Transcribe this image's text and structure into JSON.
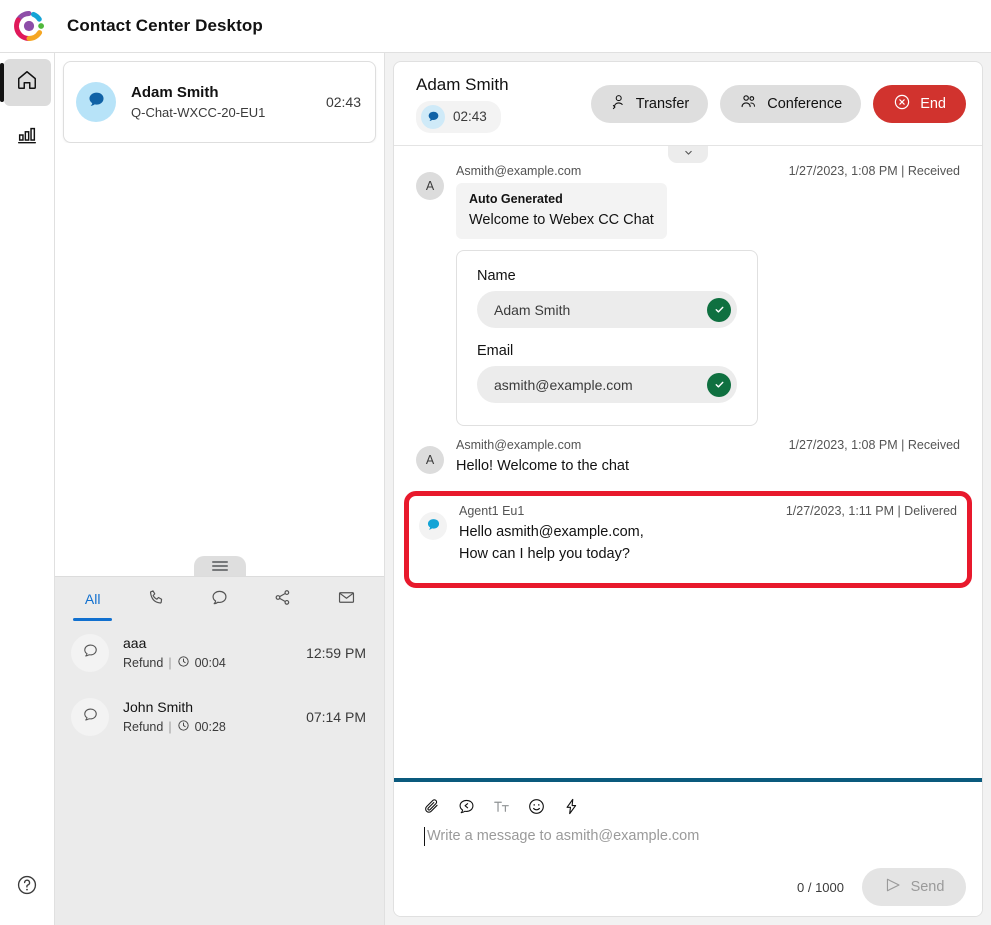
{
  "header": {
    "title": "Contact Center Desktop",
    "logo_icon": "webex-logo-icon",
    "brand_colors": {
      "purple": "#8e4ea8",
      "cyan": "#14a4d6",
      "green": "#50b83c",
      "orange": "#f5a623",
      "pink": "#e0195a"
    }
  },
  "nav_rail": {
    "items": [
      {
        "icon": "home-icon",
        "name": "home",
        "active": true
      },
      {
        "icon": "analytics-bar-chart-icon",
        "name": "analytics",
        "active": false
      }
    ],
    "help_icon": "help-circle-icon"
  },
  "active_contact": {
    "avatar_icon": "chat-bubble-icon",
    "name": "Adam Smith",
    "queue": "Q-Chat-WXCC-20-EU1",
    "timer": "02:43"
  },
  "task_list": {
    "drag_handle_icon": "hamburger-handle-icon",
    "tabs": [
      {
        "label": "All",
        "icon": "",
        "active": true,
        "name": "tab-all"
      },
      {
        "label": "",
        "icon": "phone-icon",
        "active": false,
        "name": "tab-calls"
      },
      {
        "label": "",
        "icon": "chat-icon",
        "active": false,
        "name": "tab-chats"
      },
      {
        "label": "",
        "icon": "social-share-icon",
        "active": false,
        "name": "tab-social"
      },
      {
        "label": "",
        "icon": "email-icon",
        "active": false,
        "name": "tab-email"
      }
    ],
    "rows": [
      {
        "avatar_icon": "chat-bubble-outline-icon",
        "title": "aaa",
        "queue": "Refund",
        "separator": "|",
        "clock_icon": "clock-icon",
        "duration": "00:04",
        "time": "12:59 PM"
      },
      {
        "avatar_icon": "chat-bubble-outline-icon",
        "title": "John Smith",
        "queue": "Refund",
        "separator": "|",
        "clock_icon": "clock-icon",
        "duration": "00:28",
        "time": "07:14 PM"
      }
    ]
  },
  "interaction": {
    "customer_name": "Adam Smith",
    "status_icon": "chat-bubble-icon",
    "timer": "02:43",
    "collapse_icon": "chevron-down-icon",
    "buttons": [
      {
        "label": "Transfer",
        "icon": "person-transfer-icon",
        "name": "transfer-button",
        "style": "default"
      },
      {
        "label": "Conference",
        "icon": "people-group-icon",
        "name": "conference-button",
        "style": "default"
      },
      {
        "label": "End",
        "icon": "circle-x-icon",
        "name": "end-button",
        "style": "danger"
      }
    ],
    "end_button_color": "#d1332e",
    "highlight_color": "#e8192c",
    "composer_accent_color": "#0a5a7d"
  },
  "messages": [
    {
      "avatar_text": "A",
      "avatar_type": "letter",
      "from": "Asmith@example.com",
      "timestamp": "1/27/2023, 1:08 PM | Received",
      "system_card": {
        "title": "Auto Generated",
        "text": "Welcome to Webex CC Chat"
      },
      "form": {
        "fields": [
          {
            "label": "Name",
            "value": "Adam Smith",
            "check_icon": "check-circle-icon"
          },
          {
            "label": "Email",
            "value": "asmith@example.com",
            "check_icon": "check-circle-icon"
          }
        ]
      }
    },
    {
      "avatar_text": "A",
      "avatar_type": "letter",
      "from": "Asmith@example.com",
      "timestamp": "1/27/2023, 1:08 PM | Received",
      "text": "Hello! Welcome to the chat"
    },
    {
      "avatar_type": "agent-icon",
      "from": "Agent1 Eu1",
      "timestamp": "1/27/2023, 1:11 PM | Delivered",
      "text_line1": "Hello asmith@example.com,",
      "text_line2": "How can I help you today?",
      "highlighted": true
    }
  ],
  "composer": {
    "tools": [
      {
        "icon": "attachment-paperclip-icon",
        "name": "attach-file-button"
      },
      {
        "icon": "quick-response-icon",
        "name": "quick-response-button"
      },
      {
        "icon": "text-format-icon",
        "name": "text-format-button"
      },
      {
        "icon": "emoji-icon",
        "name": "emoji-button"
      },
      {
        "icon": "lightning-bolt-icon",
        "name": "shortcut-button"
      }
    ],
    "placeholder": "Write a message to asmith@example.com",
    "value": "",
    "char_count": "0 / 1000",
    "send_label": "Send",
    "send_icon": "send-plane-icon"
  }
}
